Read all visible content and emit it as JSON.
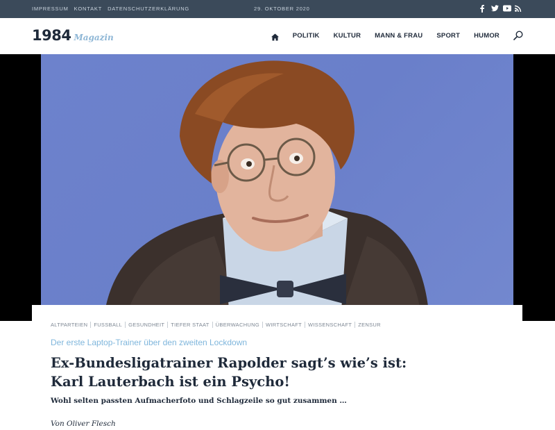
{
  "topbar": {
    "links": [
      "IMPRESSUM",
      "KONTAKT",
      "DATENSCHUTZERKLÄRUNG"
    ],
    "date": "29. OKTOBER 2020",
    "social_icons": [
      "facebook-icon",
      "twitter-icon",
      "youtube-icon",
      "rss-icon"
    ]
  },
  "header": {
    "logo_number": "1984",
    "logo_word": "Magazin",
    "nav": [
      "POLITIK",
      "KULTUR",
      "MANN & FRAU",
      "SPORT",
      "HUMOR"
    ]
  },
  "article": {
    "tags": [
      "ALTPARTEIEN",
      "FUSSBALL",
      "GESUNDHEIT",
      "TIEFER STAAT",
      "ÜBERWACHUNG",
      "WIRTSCHAFT",
      "WISSENSCHAFT",
      "ZENSUR"
    ],
    "kicker": "Der erste Laptop-Trainer über den zweiten Lockdown",
    "headline": "Ex-Bundesligatrainer Rapolder sagt’s wie’s ist: Karl Lauterbach ist ein Psycho!",
    "lead": "Wohl selten passten Aufmacherfoto und Schlagzeile so gut zusammen …",
    "author": "Von Oliver Flesch"
  },
  "colors": {
    "topbar_bg": "#3b4a5a",
    "accent": "#7fb6dc",
    "text": "#1f2a3a",
    "photo_bg": "#6d82cc"
  }
}
